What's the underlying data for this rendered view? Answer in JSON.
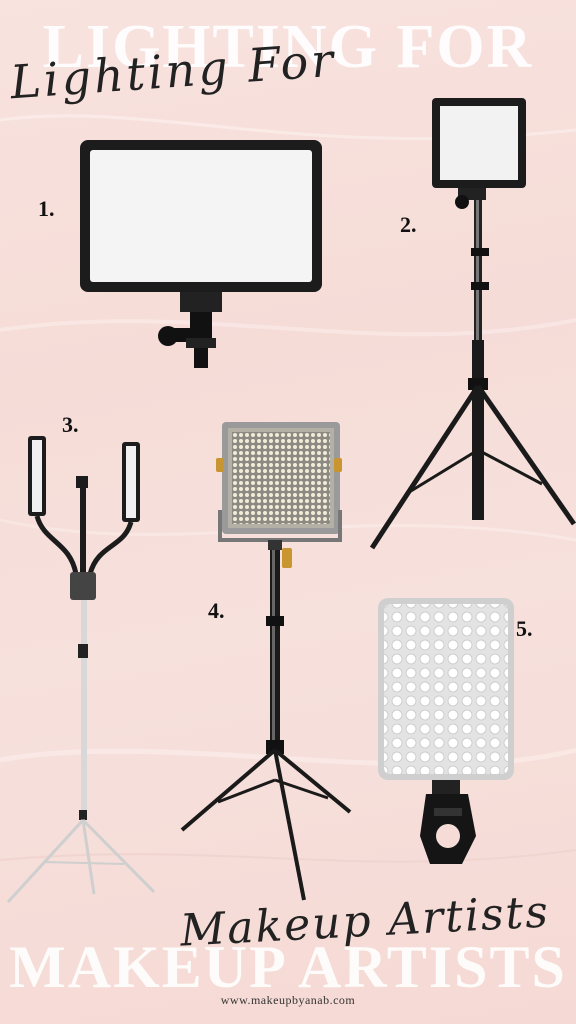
{
  "headline": {
    "background_top": "LIGHTING FOR",
    "script_top": "Lighting For",
    "background_bottom": "MAKEUP ARTISTS",
    "script_bottom": "Makeup Artists"
  },
  "products": [
    {
      "number": "1.",
      "icon": "led-panel-light-icon"
    },
    {
      "number": "2.",
      "icon": "led-panel-on-tripod-icon"
    },
    {
      "number": "3.",
      "icon": "dual-arm-led-light-stand-icon"
    },
    {
      "number": "4.",
      "icon": "bi-color-led-panel-stand-icon"
    },
    {
      "number": "5.",
      "icon": "clip-on-led-light-icon"
    }
  ],
  "footer": {
    "website": "www.makeupbyanab.com"
  },
  "colors": {
    "background": "#f7e0dc",
    "text": "#222222",
    "accent_white": "#ffffff"
  }
}
